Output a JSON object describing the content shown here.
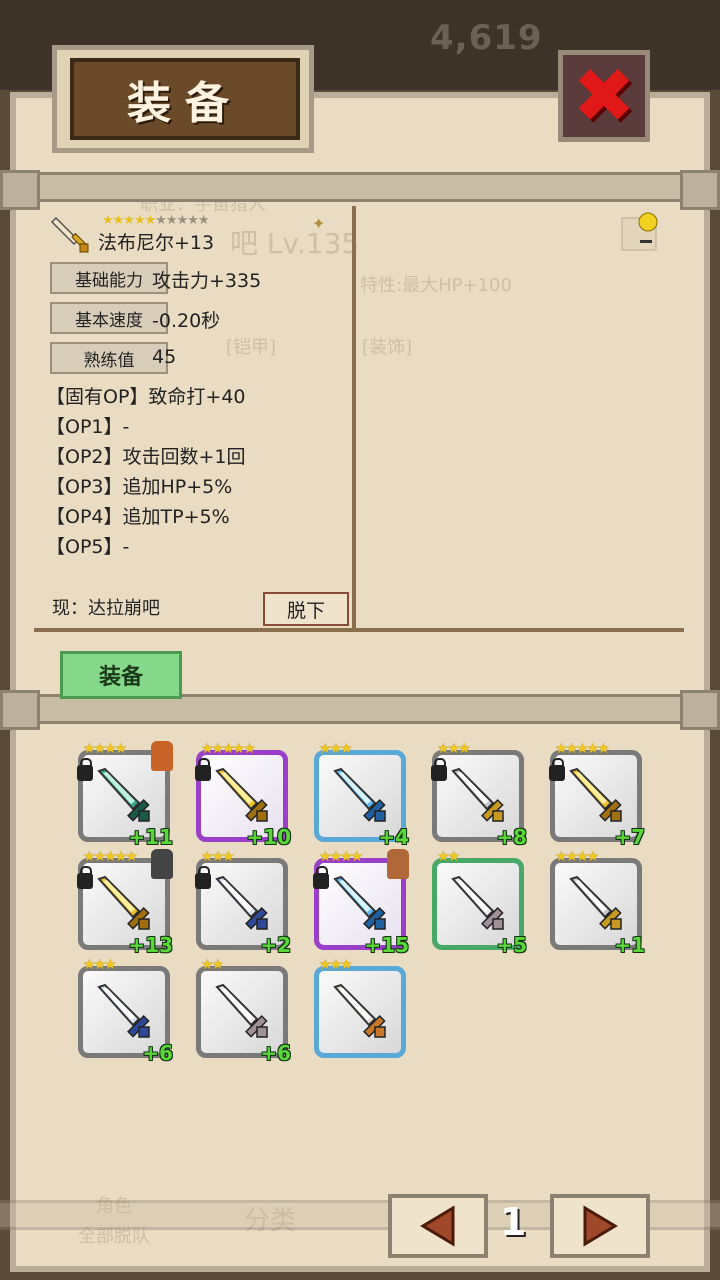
{
  "header": {
    "title": "装备",
    "gold_behind": "4,619"
  },
  "background_faded": {
    "job": "职业：宇宙猎人",
    "level": "吧 Lv.135",
    "trait": "特性:最大HP+100",
    "armor_tab": "[铠甲]",
    "accessory_tab": "[装饰]",
    "bottom_left_1": "角色",
    "bottom_left_2": "全部脱队",
    "bottom_mid": "分类"
  },
  "item_detail": {
    "name": "法布尼尔+13",
    "stars_filled": 5,
    "stars_total": 10,
    "base_ability_label": "基础能力",
    "base_ability_value": "攻击力+335",
    "base_speed_label": "基本速度",
    "base_speed_value": "-0.20秒",
    "proficiency_label": "熟练值",
    "proficiency_value": "45",
    "options": [
      "【固有OP】致命打+40",
      "【OP1】-",
      "【OP2】攻击回数+1回",
      "【OP3】追加HP+5%",
      "【OP4】追加TP+5%",
      "【OP5】-"
    ],
    "current_owner": "现：达拉崩吧",
    "unequip_label": "脱下"
  },
  "equip_button_label": "装备",
  "inventory": [
    {
      "stars": "★★★★",
      "plus": "+11",
      "frame": "gray",
      "lock": true,
      "char": "#c86428",
      "weapon": "green-curved",
      "starsNote": "lowered"
    },
    {
      "stars": "★★★★★",
      "plus": "+10",
      "frame": "purple",
      "lock": true,
      "char": "",
      "weapon": "gold"
    },
    {
      "stars": "★★★",
      "plus": "+4",
      "frame": "blue",
      "lock": false,
      "char": "",
      "weapon": "ice"
    },
    {
      "stars": "★★★",
      "plus": "+8",
      "frame": "gray",
      "lock": true,
      "char": "",
      "weapon": "silver-gold"
    },
    {
      "stars": "★★★★★",
      "plus": "+7",
      "frame": "gray",
      "lock": true,
      "char": "",
      "weapon": "gold"
    },
    {
      "stars": "★★★★★",
      "plus": "+13",
      "frame": "gray",
      "lock": true,
      "char": "#444444",
      "weapon": "gold"
    },
    {
      "stars": "★★★",
      "plus": "+2",
      "frame": "gray",
      "lock": true,
      "char": "",
      "weapon": "steel-blue"
    },
    {
      "stars": "★★★★",
      "plus": "+15",
      "frame": "purple",
      "lock": true,
      "char": "#b06838",
      "weapon": "ice"
    },
    {
      "stars": "★★",
      "plus": "+5",
      "frame": "green",
      "lock": false,
      "char": "",
      "weapon": "white"
    },
    {
      "stars": "★★★★",
      "plus": "+1",
      "frame": "gray",
      "lock": false,
      "char": "",
      "weapon": "silver-gold"
    },
    {
      "stars": "★★★",
      "plus": "+6",
      "frame": "gray",
      "lock": false,
      "char": "",
      "weapon": "steel-blue"
    },
    {
      "stars": "★★",
      "plus": "+6",
      "frame": "gray",
      "lock": false,
      "char": "",
      "weapon": "white"
    },
    {
      "stars": "★★★",
      "plus": "",
      "frame": "blue",
      "lock": false,
      "char": "",
      "weapon": "bronze"
    }
  ],
  "pagination": {
    "page": "1"
  },
  "icons": {
    "close": "close-icon",
    "prev": "arrow-left-icon",
    "next": "arrow-right-icon",
    "sword": "sword-icon",
    "lock": "lock-icon"
  },
  "colors": {
    "plus_text": "#5ad83a",
    "star": "#f0c820",
    "close_red": "#e01818"
  }
}
